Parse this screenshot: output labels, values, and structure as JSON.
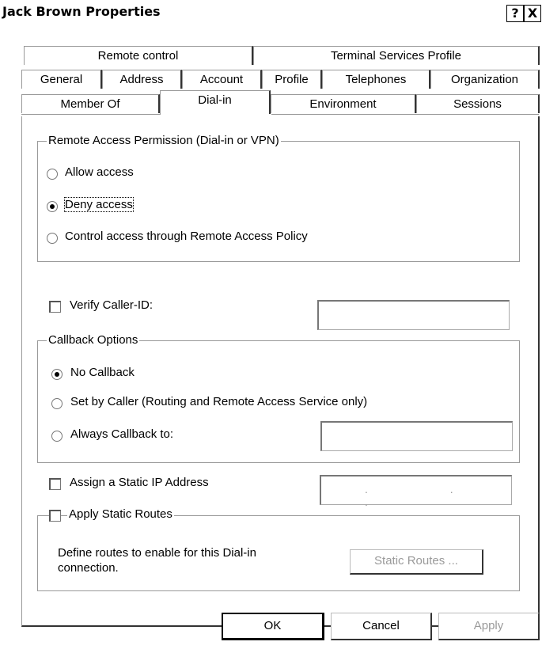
{
  "window": {
    "title": "Jack Brown Properties",
    "help": "?",
    "close": "X"
  },
  "tabs": {
    "row1": [
      "Remote control",
      "Terminal Services Profile"
    ],
    "row2": [
      "General",
      "Address",
      "Account",
      "Profile",
      "Telephones",
      "Organization"
    ],
    "row3": [
      "Member Of",
      "Dial-in",
      "Environment",
      "Sessions"
    ],
    "active": "Dial-in"
  },
  "remote_access": {
    "group_label": "Remote Access Permission (Dial-in or VPN)",
    "options": [
      "Allow access",
      "Deny access",
      "Control access through Remote Access Policy"
    ],
    "selected": "Deny access"
  },
  "verify_caller": {
    "label": "Verify Caller-ID:",
    "checked": false,
    "value": ""
  },
  "callback": {
    "group_label": "Callback Options",
    "options": [
      "No Callback",
      "Set by Caller (Routing and Remote Access Service only)",
      "Always Callback to:"
    ],
    "selected": "No Callback",
    "callback_number": ""
  },
  "static_ip": {
    "label": "Assign a Static IP Address",
    "checked": false,
    "ip_value": ". . ."
  },
  "static_routes": {
    "label": "Apply Static Routes",
    "checked": false,
    "description": "Define routes to enable for this Dial-in connection.",
    "button": "Static Routes ..."
  },
  "buttons": {
    "ok": "OK",
    "cancel": "Cancel",
    "apply": "Apply"
  },
  "colors": {
    "background": "#ffffff",
    "border_dark": "#333333",
    "border_light": "#999999",
    "disabled_text": "#9a9a9a"
  }
}
